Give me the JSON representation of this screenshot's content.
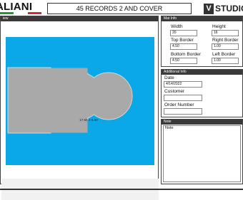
{
  "header": {
    "brand": "ALIANI",
    "title": "45 RECORDS 2 AND COVER",
    "studio_badge": "V",
    "studio_word": "STUDIO",
    "flag_colors": [
      "#1a9a3a",
      "#ffffff",
      "#d22b2b"
    ]
  },
  "preview": {
    "header": "iew",
    "size_label": "17.50 X 6.50",
    "background_color": "#0aa8e6",
    "mat_color": "#a9a9a9"
  },
  "mat_info": {
    "header": "Mat Info",
    "width_label": "Width",
    "width_value": "20",
    "height_label": "Height",
    "height_value": "16",
    "top_border_label": "Top Border",
    "top_border_value": "4.50",
    "right_border_label": "Right Border",
    "right_border_value": "1.00",
    "bottom_border_label": "Bottom Border",
    "bottom_border_value": "4.50",
    "left_border_label": "Left Border",
    "left_border_value": "1.00"
  },
  "additional_info": {
    "header": "Additional Info",
    "date_label": "Date",
    "date_value": "4/14/2022",
    "customer_label": "Customer",
    "customer_value": "",
    "order_number_label": "Order Number",
    "order_number_value": ""
  },
  "note": {
    "header": "Note",
    "label": "Note"
  }
}
